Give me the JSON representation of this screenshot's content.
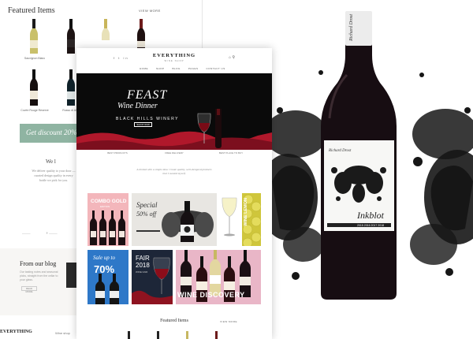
{
  "back_page": {
    "title": "Featured Items",
    "view_more": "VIEW MORE",
    "product_captions": [
      "Sauvignon Blanc",
      "",
      "",
      "",
      "Cuvée Rouge Reserve",
      "Rosso di Alba"
    ],
    "discount": "Get discount 20%",
    "section_heading": "We l",
    "paragraph": "We deliver quality to your door — curated design quality in every bottle we pick for you.",
    "blog_title": "From our blog",
    "blog_text": "Our tasting notes and seasonal picks, straight from the cellar to your glass.",
    "read_more": "READ MORE",
    "footer_logo": "EVERYTHING",
    "footer_link": "Wine shop"
  },
  "main_page": {
    "social_icons": "f  t  in",
    "logo": "EVERYTHING",
    "logo_sub": "WINE SHOP",
    "cart_icon": "cart-icon",
    "nav": [
      "HOME",
      "SHOP",
      "BLOG",
      "PAGES",
      "CONTACT US"
    ],
    "hero": {
      "title": "FEAST",
      "subtitle": "Wine Dinner",
      "winery": "BLACK HILLS WINERY",
      "button": "SHOP NOW"
    },
    "features": [
      "BEST PRODUCTS",
      "FREE DELIVERY",
      "BEST PLACE TO BUY"
    ],
    "intro": "A limited with a simple idea: Create quality, well-designed products that I wanted myself.",
    "tiles": {
      "combo": "COMBO GOLD",
      "combo_sub": "EDITION",
      "special": "Special",
      "special_off": "50% off",
      "lemon": "WINE LEMON",
      "sale": "Sale up to",
      "sale_pct": "70%",
      "fair": "FAIR",
      "fair_year": "2018",
      "fair_sub": "WINE FAIR",
      "discovery": "WINE DISCOVERY"
    },
    "featured_title": "Featured Items",
    "view_more": "VIEW MORE"
  },
  "product": {
    "brand_script": "Richard Drost",
    "label_script": "Richard Drost",
    "name_script": "Inkblot",
    "vintage": "2015 2016 2017 2018"
  }
}
